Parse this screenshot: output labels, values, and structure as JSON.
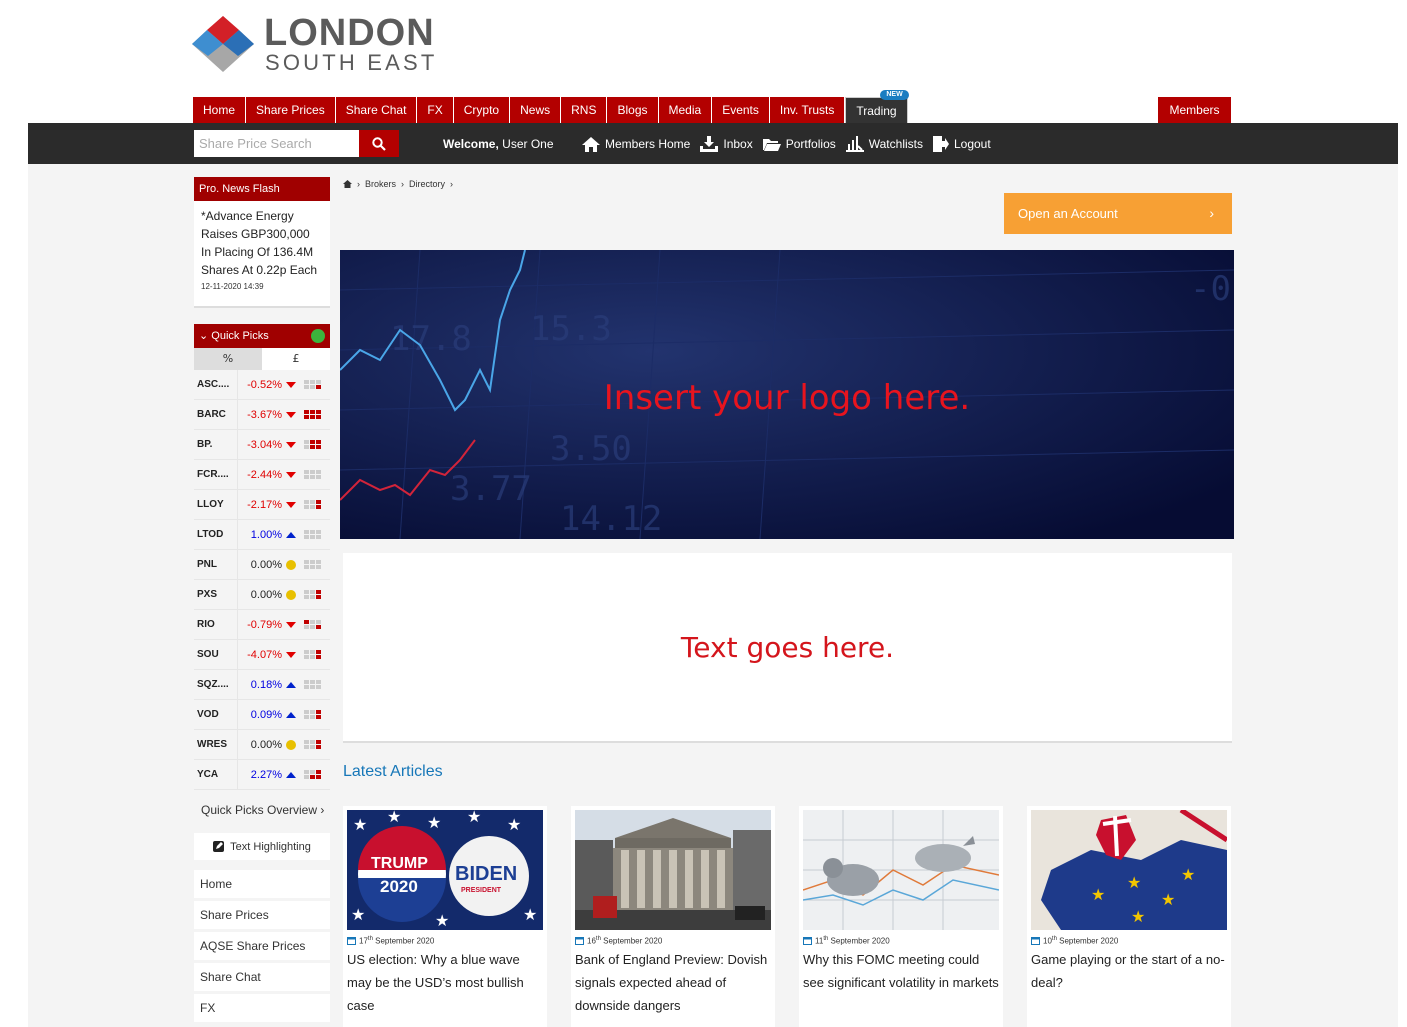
{
  "brand": {
    "line1": "LONDON",
    "line2": "SOUTH EAST"
  },
  "nav": {
    "items": [
      "Home",
      "Share Prices",
      "Share Chat",
      "FX",
      "Crypto",
      "News",
      "RNS",
      "Blogs",
      "Media",
      "Events",
      "Inv. Trusts",
      "Trading"
    ],
    "new_badge": "NEW",
    "members": "Members"
  },
  "toolbar": {
    "search_placeholder": "Share Price Search",
    "welcome_bold": "Welcome,",
    "welcome_user": "User One",
    "links": [
      "Members Home",
      "Inbox",
      "Portfolios",
      "Watchlists",
      "Logout"
    ]
  },
  "news_flash": {
    "title": "Pro. News Flash",
    "text": "*Advance Energy Raises GBP300,000 In Placing Of 136.4M Shares At 0.22p Each",
    "date": "12-11-2020 14:39"
  },
  "quick_picks": {
    "title": "Quick Picks",
    "tabs": [
      "%",
      "£"
    ],
    "rows": [
      {
        "sym": "ASC....",
        "val": "-0.52%",
        "dir": "down",
        "grid": "000001"
      },
      {
        "sym": "BARC",
        "val": "-3.67%",
        "dir": "down",
        "grid": "111111"
      },
      {
        "sym": "BP.",
        "val": "-3.04%",
        "dir": "down",
        "grid": "011011"
      },
      {
        "sym": "FCR....",
        "val": "-2.44%",
        "dir": "down",
        "grid": "000000"
      },
      {
        "sym": "LLOY",
        "val": "-2.17%",
        "dir": "down",
        "grid": "001001"
      },
      {
        "sym": "LTOD",
        "val": "1.00%",
        "dir": "up",
        "grid": "000000"
      },
      {
        "sym": "PNL",
        "val": "0.00%",
        "dir": "flat",
        "grid": "000000"
      },
      {
        "sym": "PXS",
        "val": "0.00%",
        "dir": "flat",
        "grid": "001001"
      },
      {
        "sym": "RIO",
        "val": "-0.79%",
        "dir": "down",
        "grid": "100001"
      },
      {
        "sym": "SOU",
        "val": "-4.07%",
        "dir": "down",
        "grid": "001001"
      },
      {
        "sym": "SQZ....",
        "val": "0.18%",
        "dir": "up",
        "grid": "000000"
      },
      {
        "sym": "VOD",
        "val": "0.09%",
        "dir": "up",
        "grid": "001001"
      },
      {
        "sym": "WRES",
        "val": "0.00%",
        "dir": "flat",
        "grid": "001001"
      },
      {
        "sym": "YCA",
        "val": "2.27%",
        "dir": "up",
        "grid": "001011"
      }
    ],
    "overview": "Quick Picks Overview ›",
    "text_highlighting": "Text Highlighting"
  },
  "side_links": [
    "Home",
    "Share Prices",
    "AQSE Share Prices",
    "Share Chat",
    "FX"
  ],
  "breadcrumb": [
    "Brokers",
    "Directory"
  ],
  "open_account": {
    "label": "Open an Account",
    "chevron": "›"
  },
  "banner": {
    "text": "Insert your logo here."
  },
  "text_card": {
    "text": "Text goes here."
  },
  "latest_articles": {
    "title": "Latest Articles",
    "items": [
      {
        "day": "17",
        "sup": "th",
        "rest": " September 2020",
        "title": "US election: Why a blue wave may be the USD’s most bullish case"
      },
      {
        "day": "16",
        "sup": "th",
        "rest": " September 2020",
        "title": "Bank of England Preview: Dovish signals expected ahead of downside dangers"
      },
      {
        "day": "11",
        "sup": "th",
        "rest": " September 2020",
        "title": "Why this FOMC meeting could see significant volatility in markets"
      },
      {
        "day": "10",
        "sup": "th",
        "rest": " September 2020",
        "title": "Game playing or the start of a no-deal?"
      }
    ],
    "image_text": {
      "trump": "TRUMP",
      "year": "2020",
      "biden": "BIDEN",
      "president": "PRESIDENT"
    }
  },
  "colors": {
    "brand_red": "#b30000",
    "dark_bar": "#2b2b2b",
    "accent_orange": "#f7a034",
    "link_blue": "#1777b8"
  }
}
